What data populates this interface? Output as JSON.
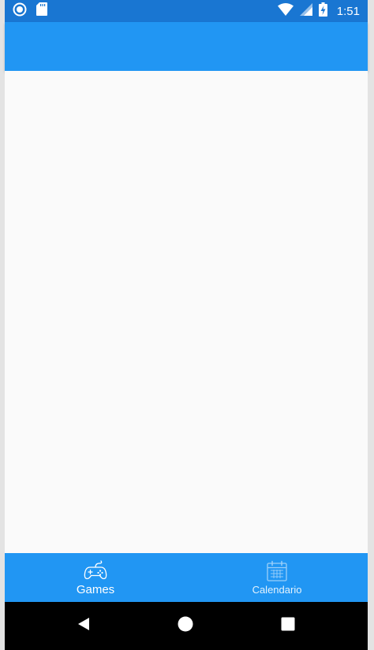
{
  "status_bar": {
    "time": "1:51",
    "icons": [
      "sync-circle-icon",
      "sd-card-icon",
      "wifi-icon",
      "signal-icon",
      "battery-charging-icon"
    ]
  },
  "app_bar": {
    "title": ""
  },
  "bottom_nav": {
    "tabs": [
      {
        "label": "Games",
        "icon": "gamepad-icon",
        "active": true
      },
      {
        "label": "Calendario",
        "icon": "calendar-icon",
        "active": false
      }
    ]
  },
  "system_nav": {
    "buttons": [
      "back-icon",
      "home-icon",
      "recent-apps-icon"
    ]
  },
  "colors": {
    "status_bar": "#1976d2",
    "primary": "#2196f3",
    "background": "#fafafa",
    "system_nav": "#000000"
  }
}
